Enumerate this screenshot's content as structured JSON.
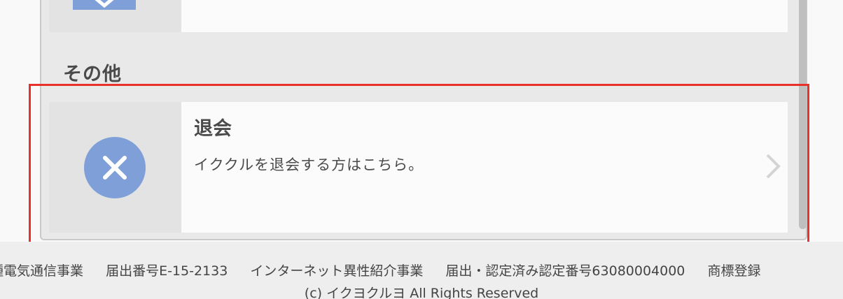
{
  "section": {
    "title": "その他"
  },
  "withdraw_item": {
    "title": "退会",
    "description": "イククルを退会する方はこちら。",
    "icon": "close-circle-icon",
    "arrow": "chevron-right-icon"
  },
  "previous_item": {
    "icon": "mail-icon"
  },
  "footer": {
    "registrations": [
      "種電気通信事業",
      "届出番号E-15-2133",
      "インターネット異性紹介事業",
      "届出・認定済み認定番号63080004000",
      "商標登録"
    ],
    "copyright": "(c) イクヨクルヨ All Rights Reserved"
  },
  "colors": {
    "icon_blue": "#7f9fd9",
    "highlight": "#e8312b"
  }
}
